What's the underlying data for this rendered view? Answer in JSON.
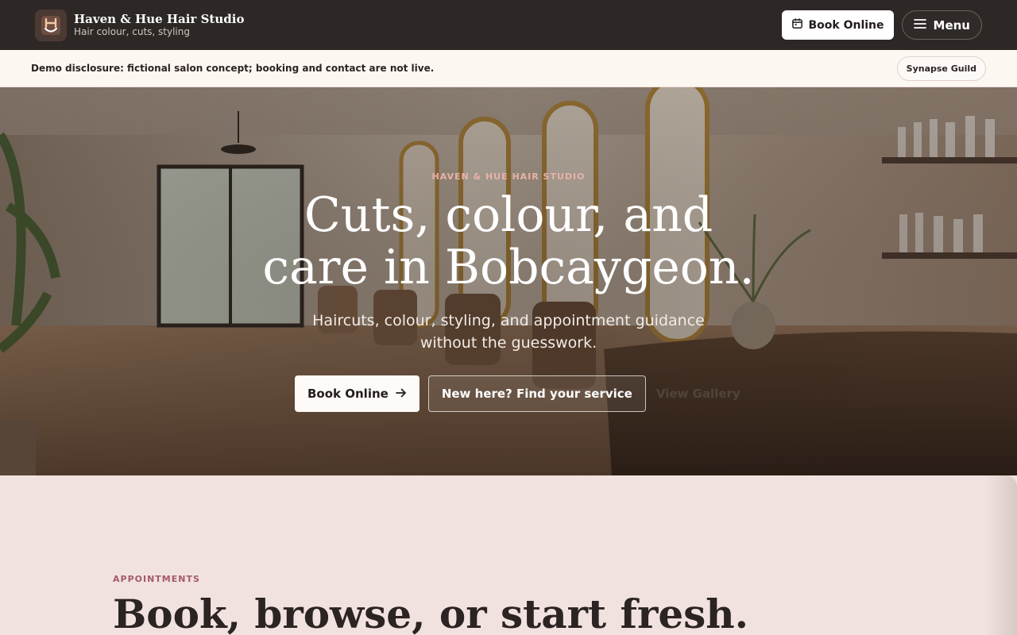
{
  "header": {
    "brand_name": "Haven & Hue Hair Studio",
    "brand_tagline": "Hair colour, cuts, styling",
    "book_label": "Book Online",
    "menu_label": "Menu"
  },
  "disclosure": {
    "text": "Demo disclosure: fictional salon concept; booking and contact are not live.",
    "badge_label": "Synapse Guild"
  },
  "hero": {
    "eyebrow": "HAVEN & HUE HAIR STUDIO",
    "title_line1": "Cuts, colour, and",
    "title_line2": "care in Bobcaygeon.",
    "subtitle": "Haircuts, colour, styling, and appointment guidance without the guesswork.",
    "cta_primary": "Book Online",
    "cta_secondary": "New here? Find your service",
    "cta_ghost": "View Gallery"
  },
  "appointments": {
    "eyebrow": "APPOINTMENTS",
    "title": "Book, browse, or start fresh."
  },
  "colors": {
    "header_bg": "#2d2826",
    "disclosure_bg": "#fdf7f2",
    "section_bg": "#f1e2e0",
    "accent": "#a45a69",
    "hero_eyebrow": "#e8b2a8"
  },
  "icons": [
    "logo-icon",
    "calendar-icon",
    "menu-icon",
    "arrow-right-icon"
  ]
}
